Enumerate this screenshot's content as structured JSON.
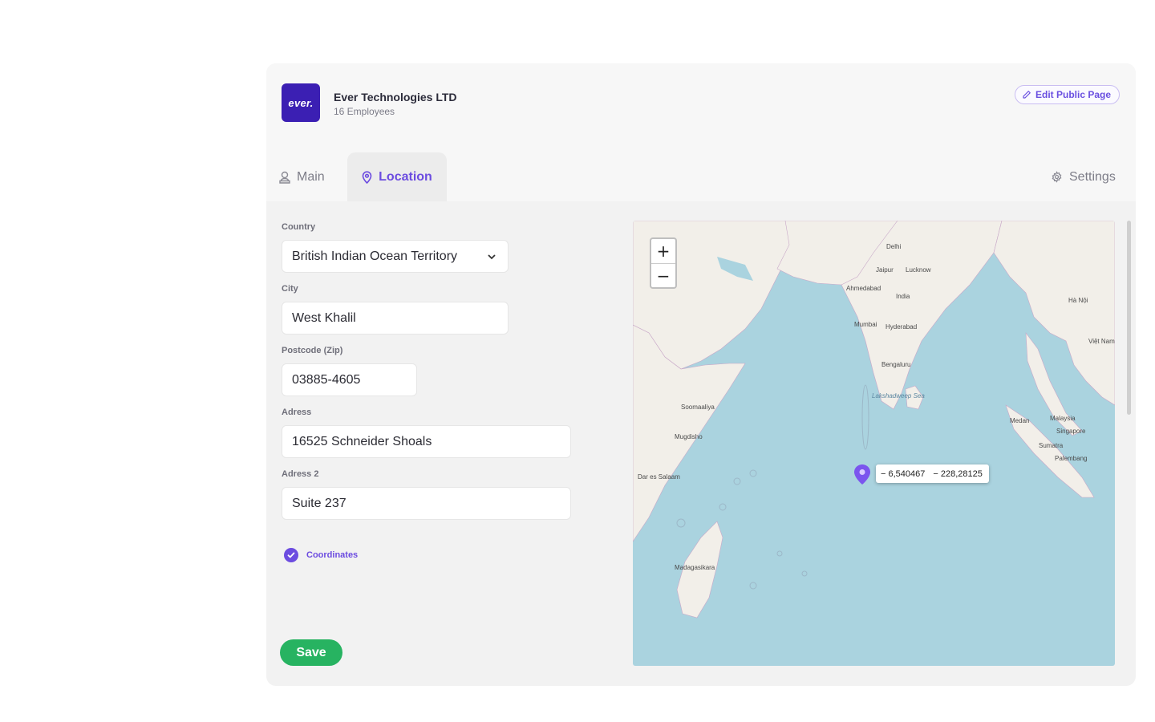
{
  "organization": {
    "logo_text": "ever.",
    "name": "Ever Technologies LTD",
    "subtitle": "16 Employees",
    "brand_color": "#3b1fb3"
  },
  "header": {
    "edit_public_page_label": "Edit Public Page"
  },
  "tabs": [
    {
      "label": "Main",
      "icon": "user-icon",
      "active": false
    },
    {
      "label": "Location",
      "icon": "map-pin-icon",
      "active": true
    },
    {
      "label": "Settings",
      "icon": "gear-icon",
      "active": false
    }
  ],
  "form": {
    "country": {
      "label": "Country",
      "value": "British Indian Ocean Territory"
    },
    "city": {
      "label": "City",
      "value": "West Khalil"
    },
    "postcode": {
      "label": "Postcode (Zip)",
      "value": "03885-4605"
    },
    "address": {
      "label": "Adress",
      "value": "16525 Schneider Shoals"
    },
    "address2": {
      "label": "Adress 2",
      "value": "Suite 237"
    },
    "coordinates": {
      "label": "Coordinates",
      "checked": true
    },
    "save_label": "Save"
  },
  "map": {
    "zoom_in": "+",
    "zoom_out": "−",
    "popup": {
      "lat": "− 6,540467",
      "lng": "− 228,28125"
    },
    "labels": [
      "Delhi",
      "Jaipur",
      "Lucknow",
      "Ahmedabad",
      "India",
      "Mumbai",
      "Hyderabad",
      "Bengaluru",
      "Lakshadweep Sea",
      "Soomaaliya",
      "Mugdisho",
      "Dar es Salaam",
      "Madagasikara",
      "Medan",
      "Malaysia",
      "Singapore",
      "Sumatra",
      "Palembang",
      "Hà Nội",
      "Việt Nam"
    ]
  },
  "colors": {
    "accent": "#6c4ce0",
    "save": "#27b361",
    "ocean": "#aad3df",
    "land": "#f2efe9"
  }
}
